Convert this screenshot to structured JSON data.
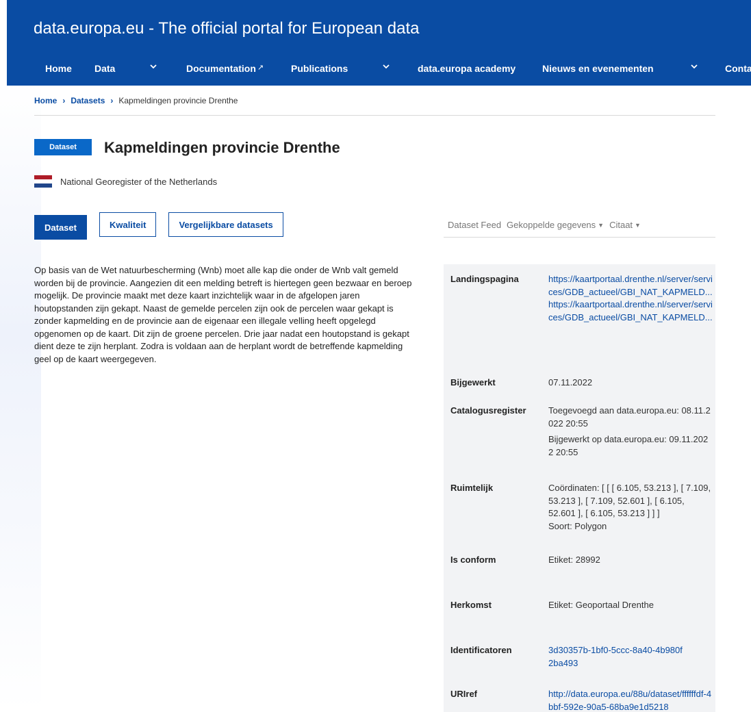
{
  "site": {
    "title": "data.europa.eu - The official portal for European data"
  },
  "nav": {
    "items": [
      {
        "label": "Home"
      },
      {
        "label": "Data"
      },
      {
        "label": "Documentation"
      },
      {
        "label": "Publications"
      },
      {
        "label": "data.europa academy"
      },
      {
        "label": "Nieuws en evenementen"
      },
      {
        "label": "Conta"
      }
    ],
    "external_icon": "external-link-icon"
  },
  "breadcrumb": {
    "home": "Home",
    "datasets": "Datasets",
    "current": "Kapmeldingen provincie Drenthe"
  },
  "dataset": {
    "badge": "Dataset",
    "title": "Kapmeldingen provincie Drenthe",
    "publisher": "National Georegister of the Netherlands",
    "flag_colors": [
      "#ae1c28",
      "#ffffff",
      "#21468b"
    ],
    "description": "Op basis van de Wet natuurbescherming (Wnb) moet alle kap die onder de Wnb valt gemeld worden bij de provincie. Aangezien dit een melding betreft is hiertegen geen bezwaar en beroep mogelijk. De provincie maakt met deze kaart inzichtelijk waar in de afgelopen jaren houtopstanden zijn gekapt. Naast de gemelde percelen zijn ook de percelen waar gekapt is zonder kapmelding en de provincie aan de eigenaar een illegale velling heeft opgelegd opgenomen op de kaart. Dit zijn de groene percelen. Drie jaar nadat een houtopstand is gekapt dient deze te zijn herplant. Zodra is voldaan aan de herplant wordt de betreffende kapmelding geel op de kaart weergegeven."
  },
  "tabs": [
    {
      "label": "Dataset"
    },
    {
      "label": "Kwaliteit"
    },
    {
      "label": "Vergelijkbare datasets"
    }
  ],
  "feed": {
    "dataset_feed": "Dataset Feed",
    "linked": "Gekoppelde gegevens",
    "cite": "Citaat"
  },
  "meta": {
    "landing_label": "Landingspagina",
    "landing_1": "https://kaartportaal.drenthe.nl/server/services/GDB_actueel/GBI_NAT_KAPMELD...",
    "landing_2": "https://kaartportaal.drenthe.nl/server/services/GDB_actueel/GBI_NAT_KAPMELD...",
    "updated_label": "Bijgewerkt",
    "updated": "07.11.2022",
    "catalog_label": "Catalogusregister",
    "catalog_added": "Toegevoegd aan data.europa.eu: 08.11.2022 20:55",
    "catalog_updated": "Bijgewerkt op data.europa.eu: 09.11.2022 20:55",
    "spatial_label": "Ruimtelijk",
    "spatial_coords": "Coördinaten: [ [ [ 6.105, 53.213 ], [ 7.109, 53.213 ], [ 7.109, 52.601 ], [ 6.105, 52.601 ], [ 6.105, 53.213 ] ] ]",
    "spatial_type": "Soort: Polygon",
    "conform_label": "Is conform",
    "conform": "Etiket: 28992",
    "provenance_label": "Herkomst",
    "provenance": "Etiket: Geoportaal Drenthe",
    "identifiers_label": "Identificatoren",
    "identifiers": "3d30357b-1bf0-5ccc-8a40-4b980f2ba493",
    "uriref_label": "URIref",
    "uriref": "http://data.europa.eu/88u/dataset/ffffffdf-4bbf-592e-90a5-68ba9e1d5218"
  }
}
